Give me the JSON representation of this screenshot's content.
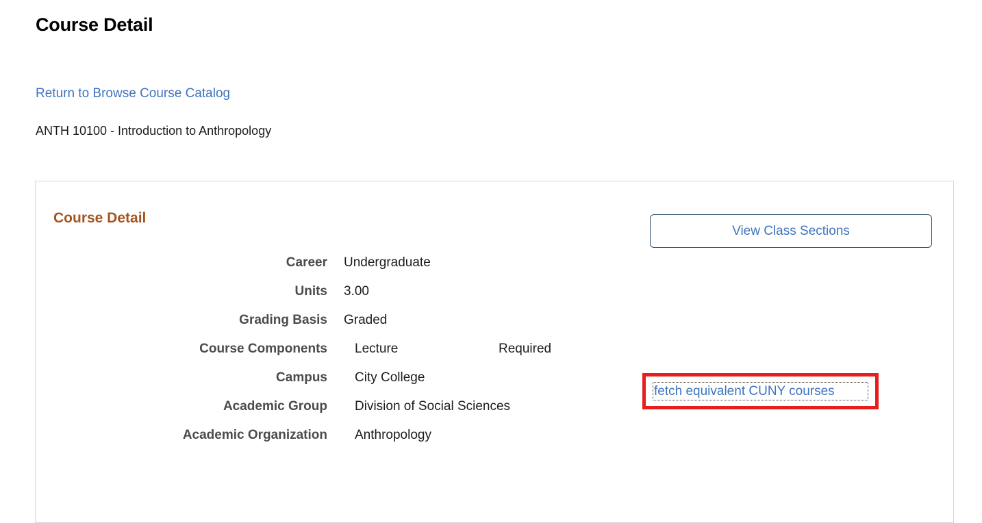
{
  "page": {
    "title": "Course Detail",
    "return_link": "Return to Browse Course Catalog",
    "course_code_title": "ANTH 10100 - Introduction to Anthropology"
  },
  "panel": {
    "heading": "Course Detail",
    "view_sections_button": "View Class Sections",
    "fetch_link": "fetch equivalent CUNY courses",
    "rows": [
      {
        "label": "Career",
        "value": "Undergraduate",
        "value2": ""
      },
      {
        "label": "Units",
        "value": "3.00",
        "value2": ""
      },
      {
        "label": "Grading Basis",
        "value": "Graded",
        "value2": ""
      },
      {
        "label": "Course Components",
        "value": "Lecture",
        "value2": "Required"
      },
      {
        "label": "Campus",
        "value": "City College",
        "value2": ""
      },
      {
        "label": "Academic Group",
        "value": "Division of Social Sciences",
        "value2": ""
      },
      {
        "label": "Academic Organization",
        "value": "Anthropology",
        "value2": ""
      }
    ]
  },
  "colors": {
    "link_blue": "#3e74be",
    "heading_brown": "#a4551f",
    "label_gray": "#4b4b4b",
    "button_border": "#2e5170",
    "highlight_red": "#e81d1d",
    "panel_border": "#d7d7d7",
    "background": "#ffffff"
  }
}
